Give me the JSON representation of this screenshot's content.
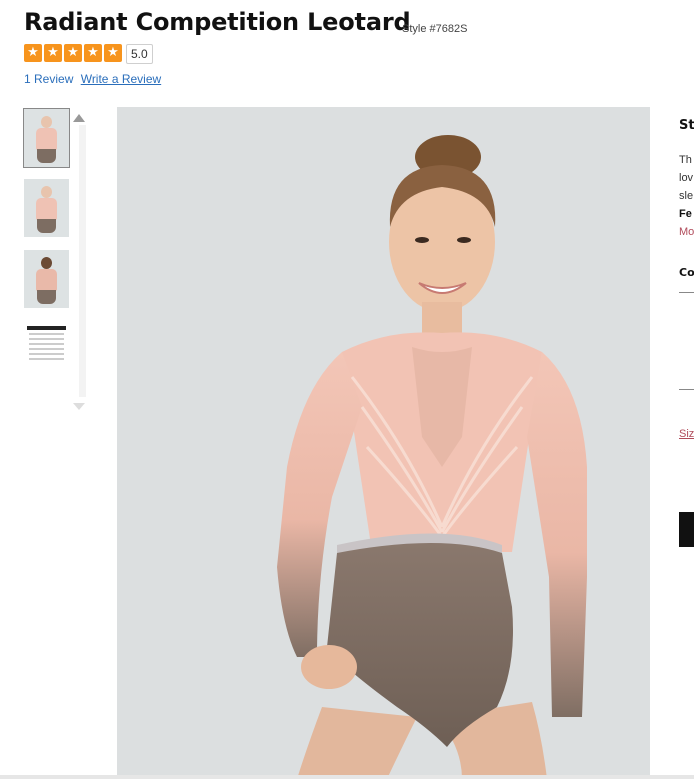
{
  "product": {
    "title": "Radiant Competition Leotard",
    "style_number": "Style #7682S"
  },
  "rating": {
    "value": "5.0",
    "stars_filled": 5,
    "stars_total": 5,
    "star_glyph": "★",
    "star_color": "#f7941d"
  },
  "reviews": {
    "count_label": "1 Review",
    "write_label": "Write a Review",
    "link_color": "#2a6ebb"
  },
  "gallery": {
    "thumbnails": [
      {
        "alt_icon": "leotard-front-photo"
      },
      {
        "alt_icon": "leotard-front-photo"
      },
      {
        "alt_icon": "leotard-back-photo"
      },
      {
        "alt_icon": "size-chart-image"
      }
    ],
    "selected_index": 0,
    "main_image_icon": "model-wearing-leotard-photo"
  },
  "details_panel": {
    "heading": "St",
    "desc_line1": "Th",
    "desc_line2": "lov",
    "desc_line3": "sle",
    "desc_bold": "Fe",
    "more_link": "Mo",
    "color_heading": "Co",
    "size_link": "Siz"
  },
  "colors": {
    "leotard_top": "#f2c3b4",
    "leotard_bottom": "#7b6b60",
    "background": "#dcdfe0"
  }
}
